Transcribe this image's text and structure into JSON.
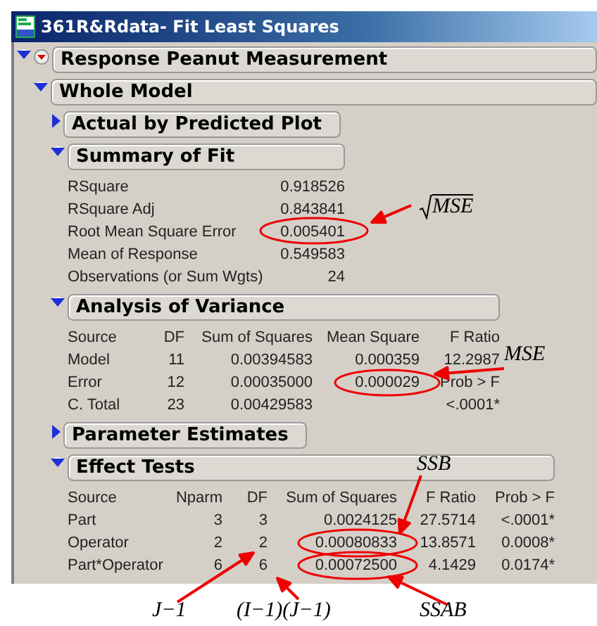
{
  "window": {
    "title": "361R&Rdata- Fit Least Squares"
  },
  "report": {
    "title": "Response Peanut Measurement",
    "expanded": true,
    "children": [
      {
        "title": "Whole Model",
        "expanded": true,
        "children": [
          {
            "title": "Actual by Predicted Plot",
            "expanded": false
          },
          {
            "title": "Summary of Fit",
            "expanded": true,
            "kind": "summary",
            "rows": [
              [
                "RSquare",
                "0.918526"
              ],
              [
                "RSquare Adj",
                "0.843841"
              ],
              [
                "Root Mean Square Error",
                "0.005401"
              ],
              [
                "Mean of Response",
                "0.549583"
              ],
              [
                "Observations (or Sum Wgts)",
                "24"
              ]
            ]
          },
          {
            "title": "Analysis of Variance",
            "expanded": true,
            "kind": "table",
            "columns": [
              "Source",
              "DF",
              "Sum of Squares",
              "Mean Square",
              "F Ratio"
            ],
            "rows": [
              [
                "Model",
                "11",
                "0.00394583",
                "0.000359",
                "12.2987"
              ],
              [
                "Error",
                "12",
                "0.00035000",
                "0.000029",
                "Prob > F"
              ],
              [
                "C. Total",
                "23",
                "0.00429583",
                "",
                "<.0001*"
              ]
            ]
          },
          {
            "title": "Parameter Estimates",
            "expanded": false
          },
          {
            "title": "Effect Tests",
            "expanded": true,
            "kind": "table",
            "columns": [
              "Source",
              "Nparm",
              "DF",
              "Sum of Squares",
              "F Ratio",
              "Prob > F"
            ],
            "rows": [
              [
                "Part",
                "3",
                "3",
                "0.0024125",
                "27.5714",
                "<.0001*"
              ],
              [
                "Operator",
                "2",
                "2",
                "0.00080833",
                "13.8571",
                "0.0008*"
              ],
              [
                "Part*Operator",
                "6",
                "6",
                "0.00072500",
                "4.1429",
                "0.0174*"
              ]
            ]
          }
        ]
      }
    ]
  },
  "annotations": [
    {
      "text": "MSE",
      "kind": "sqrt"
    },
    {
      "text": "MSE",
      "kind": "plain"
    },
    {
      "text": "SSB",
      "kind": "plain"
    },
    {
      "text": "J−1",
      "kind": "plain"
    },
    {
      "text": "(I−1)(J−1)",
      "kind": "plain"
    },
    {
      "text": "SSAB",
      "kind": "plain"
    }
  ]
}
